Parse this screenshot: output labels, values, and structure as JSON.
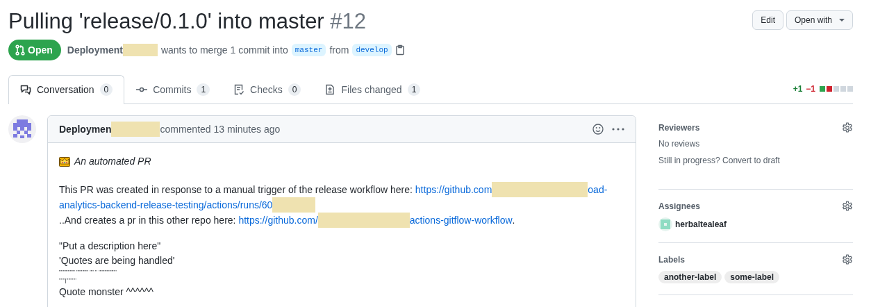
{
  "title": {
    "text": "Pulling 'release/0.1.0' into master",
    "number": "#12"
  },
  "header_buttons": [
    {
      "label": "Edit",
      "dropdown": false
    },
    {
      "label": "Open with",
      "dropdown": true
    }
  ],
  "state": {
    "label": "Open"
  },
  "summary": {
    "author": "Deployment",
    "text_1": "wants to merge 1 commit into",
    "base": "master",
    "text_2": "from",
    "head": "develop"
  },
  "tabs": [
    {
      "label": "Conversation",
      "count": "0",
      "selected": true
    },
    {
      "label": "Commits",
      "count": "1",
      "selected": false
    },
    {
      "label": "Checks",
      "count": "0",
      "selected": false
    },
    {
      "label": "Files changed",
      "count": "1",
      "selected": false
    }
  ],
  "diffstat": {
    "added": "+1",
    "removed": "−1",
    "blocks": [
      {
        "color": "#2da44e"
      },
      {
        "color": "#cf222e"
      },
      {
        "color": "#d0d7de"
      },
      {
        "color": "#d0d7de"
      },
      {
        "color": "#d0d7de"
      }
    ]
  },
  "comment": {
    "author": "Deploymen",
    "action": "commented 13 minutes ago",
    "paragraphs": [
      {
        "kind": "crown",
        "lines": [
          [
            {
              "kind": "italic",
              "text": "An automated PR"
            }
          ]
        ]
      },
      {
        "kind": "plain",
        "lines": [
          [
            {
              "kind": "text",
              "text": "This PR was created in response to a manual trigger of the release workflow here: "
            },
            {
              "kind": "link",
              "text": "https://github.com"
            },
            {
              "kind": "redaction"
            },
            {
              "kind": "link",
              "text": "oad-"
            }
          ],
          [
            {
              "kind": "link",
              "text": "analytics-backend-release-testing/actions/runs/60"
            },
            {
              "kind": "redaction"
            }
          ],
          [
            {
              "kind": "text",
              "text": "..And creates a pr in this other repo here: "
            },
            {
              "kind": "link",
              "text": "https://github.com/"
            },
            {
              "kind": "redaction"
            },
            {
              "kind": "link",
              "text": "actions-gitflow-workflow"
            },
            {
              "kind": "text",
              "text": "."
            }
          ]
        ]
      },
      {
        "kind": "plain",
        "lines": [
          [
            {
              "kind": "text",
              "text": "\"Put a description here\""
            }
          ],
          [
            {
              "kind": "text",
              "text": "'Quotes are being handled'"
            }
          ],
          [
            {
              "kind": "tiny",
              "text": "\"\"\"\"\"\"\"\" \"\"\"\"\"\" \"\" \" \"\"\"\"\"\"\"\"\""
            }
          ],
          [
            {
              "kind": "tiny",
              "text": "\"\"\"|\"\"\"\"\""
            }
          ],
          [
            {
              "kind": "text",
              "text": "Quote monster ^^^^^^"
            }
          ]
        ]
      }
    ]
  },
  "sidebar": [
    {
      "heading": "Reviewers",
      "lines": [
        "No reviews",
        "Still in progress? Convert to draft"
      ]
    },
    {
      "heading": "Assignees",
      "assignees": [
        "herbaltealeaf"
      ]
    },
    {
      "heading": "Labels",
      "labels": [
        "another-label",
        "some-label"
      ]
    }
  ]
}
